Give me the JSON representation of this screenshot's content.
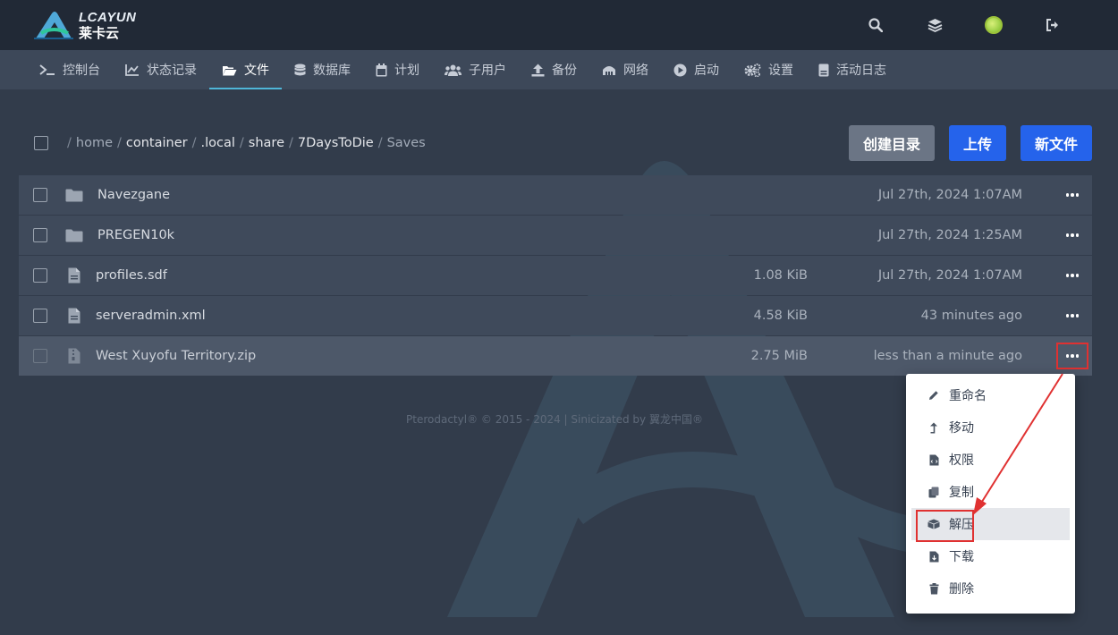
{
  "brand": {
    "name_en": "LCAYUN",
    "name_cn": "莱卡云"
  },
  "nav": {
    "items": [
      {
        "label": "控制台",
        "icon": "terminal-icon"
      },
      {
        "label": "状态记录",
        "icon": "chart-line-icon"
      },
      {
        "label": "文件",
        "icon": "folder-open-icon",
        "active": true
      },
      {
        "label": "数据库",
        "icon": "database-icon"
      },
      {
        "label": "计划",
        "icon": "calendar-icon"
      },
      {
        "label": "子用户",
        "icon": "users-icon"
      },
      {
        "label": "备份",
        "icon": "upload-icon"
      },
      {
        "label": "网络",
        "icon": "network-icon"
      },
      {
        "label": "启动",
        "icon": "play-circle-icon"
      },
      {
        "label": "设置",
        "icon": "cogs-icon"
      },
      {
        "label": "活动日志",
        "icon": "log-icon"
      }
    ]
  },
  "breadcrumb": {
    "items": [
      "home",
      "container",
      ".local",
      "share",
      "7DaysToDie",
      "Saves"
    ]
  },
  "toolbar": {
    "create_dir": "创建目录",
    "upload": "上传",
    "new_file": "新文件"
  },
  "files": [
    {
      "name": "Navezgane",
      "type": "folder",
      "size": "",
      "modified": "Jul 27th, 2024 1:07AM"
    },
    {
      "name": "PREGEN10k",
      "type": "folder",
      "size": "",
      "modified": "Jul 27th, 2024 1:25AM"
    },
    {
      "name": "profiles.sdf",
      "type": "file",
      "size": "1.08 KiB",
      "modified": "Jul 27th, 2024 1:07AM"
    },
    {
      "name": "serveradmin.xml",
      "type": "file",
      "size": "4.58 KiB",
      "modified": "43 minutes ago"
    },
    {
      "name": "West Xuyofu Territory.zip",
      "type": "archive",
      "size": "2.75 MiB",
      "modified": "less than a minute ago",
      "selected": true
    }
  ],
  "footer": "Pterodactyl® © 2015 - 2024 | Sinicizated by 翼龙中国®",
  "context_menu": {
    "items": [
      {
        "label": "重命名",
        "icon": "pencil-icon"
      },
      {
        "label": "移动",
        "icon": "level-up-icon"
      },
      {
        "label": "权限",
        "icon": "file-code-icon"
      },
      {
        "label": "复制",
        "icon": "copy-icon"
      },
      {
        "label": "解压",
        "icon": "boxes-icon",
        "hover": true
      },
      {
        "label": "下载",
        "icon": "file-download-icon"
      },
      {
        "label": "删除",
        "icon": "trash-icon"
      }
    ]
  },
  "colors": {
    "page_bg": "#323c4b",
    "topbar_bg": "#212936",
    "navbar_bg": "#3d4859",
    "row_bg": "#3f4a5b",
    "accent": "#4fb6d8",
    "primary_button": "#2563eb",
    "annotation_red": "#e03131"
  }
}
